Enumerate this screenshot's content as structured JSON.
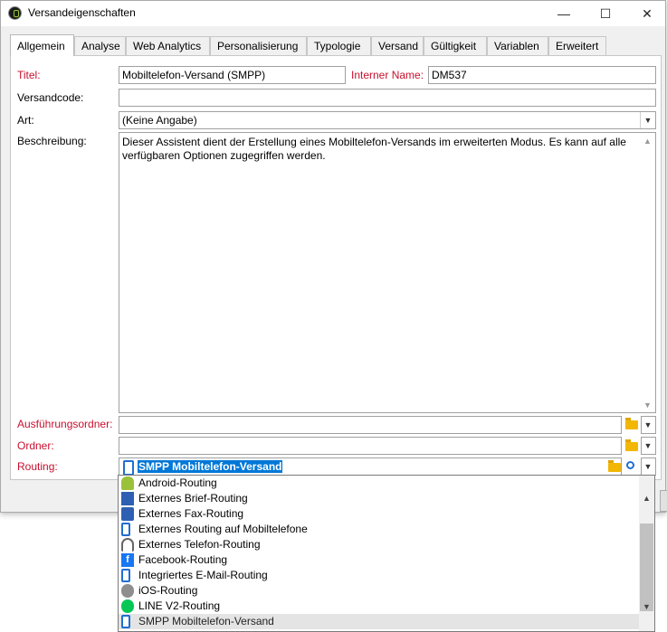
{
  "window": {
    "title": "Versandeigenschaften",
    "minimize": "—",
    "maximize": "☐",
    "close": "✕"
  },
  "tabs": [
    "Allgemein",
    "Analyse",
    "Web Analytics",
    "Personalisierung",
    "Typologie",
    "Versand",
    "Gültigkeit",
    "Variablen",
    "Erweitert"
  ],
  "active_tab": "Allgemein",
  "form": {
    "titel_label": "Titel:",
    "titel_value": "Mobiltelefon-Versand (SMPP)",
    "interner_name_label": "Interner Name:",
    "interner_name_value": "DM537",
    "versandcode_label": "Versandcode:",
    "versandcode_value": "",
    "art_label": "Art:",
    "art_value": "(Keine Angabe)",
    "beschreibung_label": "Beschreibung:",
    "beschreibung_value": "Dieser Assistent dient der Erstellung eines Mobiltelefon-Versands im erweiterten Modus. Es kann auf alle verfügbaren Optionen zugegriffen werden.",
    "ausfuehrungsordner_label": "Ausführungsordner:",
    "ausfuehrungsordner_value": "",
    "ordner_label": "Ordner:",
    "ordner_value": "",
    "routing_label": "Routing:",
    "routing_value": "SMPP Mobiltelefon-Versand"
  },
  "routing_options": [
    {
      "label": "Android-Routing",
      "icon": "android-icon"
    },
    {
      "label": "Externes Brief-Routing",
      "icon": "letter-icon"
    },
    {
      "label": "Externes Fax-Routing",
      "icon": "fax-icon"
    },
    {
      "label": "Externes Routing auf Mobiltelefone",
      "icon": "mobile-phone-icon"
    },
    {
      "label": "Externes Telefon-Routing",
      "icon": "telephone-icon"
    },
    {
      "label": "Facebook-Routing",
      "icon": "facebook-icon"
    },
    {
      "label": "Integriertes E-Mail-Routing",
      "icon": "email-icon"
    },
    {
      "label": "iOS-Routing",
      "icon": "apple-icon"
    },
    {
      "label": "LINE V2-Routing",
      "icon": "line-icon"
    },
    {
      "label": "SMPP Mobiltelefon-Versand",
      "icon": "mobile-phone-icon",
      "selected": true
    }
  ],
  "colors": {
    "required_label": "#c8102e",
    "selection": "#0078d7",
    "folder": "#f2b705"
  }
}
